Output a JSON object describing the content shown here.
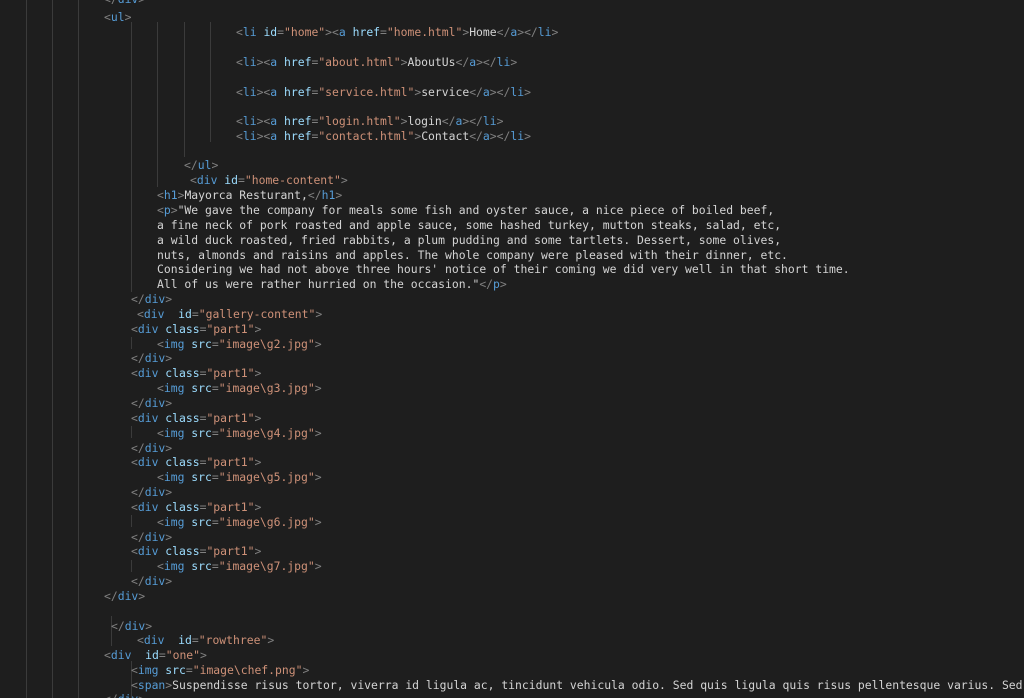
{
  "colors": {
    "background": "#1e1e1e",
    "tag": "#569cd6",
    "punctuation": "#808080",
    "attribute": "#9cdcfe",
    "string": "#ce9178",
    "text": "#d4d4d4",
    "indent_guide": "#3b3b3b"
  },
  "lines": [
    {
      "t": [
        [
          "p",
          "</"
        ],
        [
          "k",
          "div"
        ],
        [
          "p",
          ">"
        ]
      ]
    },
    {
      "t": [
        [
          "p",
          "<"
        ],
        [
          "k",
          "ul"
        ],
        [
          "p",
          ">"
        ]
      ]
    },
    {
      "t": [
        [
          "p",
          "<"
        ],
        [
          "k",
          "li"
        ],
        [
          "w",
          " "
        ],
        [
          "a",
          "id"
        ],
        [
          "p",
          "="
        ],
        [
          "s",
          "\"home\""
        ],
        [
          "p",
          "><"
        ],
        [
          "k",
          "a"
        ],
        [
          "w",
          " "
        ],
        [
          "a",
          "href"
        ],
        [
          "p",
          "="
        ],
        [
          "s",
          "\"home.html\""
        ],
        [
          "p",
          ">"
        ],
        [
          "x",
          "Home"
        ],
        [
          "p",
          "</"
        ],
        [
          "k",
          "a"
        ],
        [
          "p",
          "></"
        ],
        [
          "k",
          "li"
        ],
        [
          "p",
          ">"
        ]
      ]
    },
    {
      "t": [
        [
          "p",
          "<"
        ],
        [
          "k",
          "li"
        ],
        [
          "p",
          "><"
        ],
        [
          "k",
          "a"
        ],
        [
          "w",
          " "
        ],
        [
          "a",
          "href"
        ],
        [
          "p",
          "="
        ],
        [
          "s",
          "\"about.html\""
        ],
        [
          "p",
          ">"
        ],
        [
          "x",
          "AboutUs"
        ],
        [
          "p",
          "</"
        ],
        [
          "k",
          "a"
        ],
        [
          "p",
          "></"
        ],
        [
          "k",
          "li"
        ],
        [
          "p",
          ">"
        ]
      ]
    },
    {
      "t": [
        [
          "p",
          "<"
        ],
        [
          "k",
          "li"
        ],
        [
          "p",
          "><"
        ],
        [
          "k",
          "a"
        ],
        [
          "w",
          " "
        ],
        [
          "a",
          "href"
        ],
        [
          "p",
          "="
        ],
        [
          "s",
          "\"service.html\""
        ],
        [
          "p",
          ">"
        ],
        [
          "x",
          "service"
        ],
        [
          "p",
          "</"
        ],
        [
          "k",
          "a"
        ],
        [
          "p",
          "></"
        ],
        [
          "k",
          "li"
        ],
        [
          "p",
          ">"
        ]
      ]
    },
    {
      "t": [
        [
          "p",
          "<"
        ],
        [
          "k",
          "li"
        ],
        [
          "p",
          "><"
        ],
        [
          "k",
          "a"
        ],
        [
          "w",
          " "
        ],
        [
          "a",
          "href"
        ],
        [
          "p",
          "="
        ],
        [
          "s",
          "\"login.html\""
        ],
        [
          "p",
          ">"
        ],
        [
          "x",
          "login"
        ],
        [
          "p",
          "</"
        ],
        [
          "k",
          "a"
        ],
        [
          "p",
          "></"
        ],
        [
          "k",
          "li"
        ],
        [
          "p",
          ">"
        ]
      ]
    },
    {
      "t": [
        [
          "p",
          "<"
        ],
        [
          "k",
          "li"
        ],
        [
          "p",
          "><"
        ],
        [
          "k",
          "a"
        ],
        [
          "w",
          " "
        ],
        [
          "a",
          "href"
        ],
        [
          "p",
          "="
        ],
        [
          "s",
          "\"contact.html\""
        ],
        [
          "p",
          ">"
        ],
        [
          "x",
          "Contact"
        ],
        [
          "p",
          "</"
        ],
        [
          "k",
          "a"
        ],
        [
          "p",
          "></"
        ],
        [
          "k",
          "li"
        ],
        [
          "p",
          ">"
        ]
      ]
    },
    {
      "t": [
        [
          "p",
          "</"
        ],
        [
          "k",
          "ul"
        ],
        [
          "p",
          ">"
        ]
      ]
    },
    {
      "t": [
        [
          "p",
          "<"
        ],
        [
          "k",
          "div"
        ],
        [
          "w",
          " "
        ],
        [
          "a",
          "id"
        ],
        [
          "p",
          "="
        ],
        [
          "s",
          "\"home-content\""
        ],
        [
          "p",
          ">"
        ]
      ]
    },
    {
      "t": [
        [
          "p",
          "<"
        ],
        [
          "k",
          "h1"
        ],
        [
          "p",
          ">"
        ],
        [
          "x",
          "Mayorca Resturant,"
        ],
        [
          "p",
          "</"
        ],
        [
          "k",
          "h1"
        ],
        [
          "p",
          ">"
        ]
      ]
    },
    {
      "t": [
        [
          "p",
          "<"
        ],
        [
          "k",
          "p"
        ],
        [
          "p",
          ">"
        ],
        [
          "x",
          "\"We gave the company for meals some fish and oyster sauce, a nice piece of boiled beef,"
        ]
      ]
    },
    {
      "t": [
        [
          "x",
          "a fine neck of pork roasted and apple sauce, some hashed turkey, mutton steaks, salad, etc,"
        ]
      ]
    },
    {
      "t": [
        [
          "x",
          "a wild duck roasted, fried rabbits, a plum pudding and some tartlets. Dessert, some olives,"
        ]
      ]
    },
    {
      "t": [
        [
          "x",
          "nuts, almonds and raisins and apples. The whole company were pleased with their dinner, etc."
        ]
      ]
    },
    {
      "t": [
        [
          "x",
          "Considering we had not above three hours' notice of their coming we did very well in that short time."
        ]
      ]
    },
    {
      "t": [
        [
          "x",
          "All of us were rather hurried on the occasion.\""
        ],
        [
          "p",
          "</"
        ],
        [
          "k",
          "p"
        ],
        [
          "p",
          ">"
        ]
      ]
    },
    {
      "t": [
        [
          "p",
          "</"
        ],
        [
          "k",
          "div"
        ],
        [
          "p",
          ">"
        ]
      ]
    },
    {
      "t": [
        [
          "p",
          "<"
        ],
        [
          "k",
          "div"
        ],
        [
          "w",
          "  "
        ],
        [
          "a",
          "id"
        ],
        [
          "p",
          "="
        ],
        [
          "s",
          "\"gallery-content\""
        ],
        [
          "p",
          ">"
        ]
      ]
    },
    {
      "t": [
        [
          "p",
          "<"
        ],
        [
          "k",
          "div"
        ],
        [
          "w",
          " "
        ],
        [
          "a",
          "class"
        ],
        [
          "p",
          "="
        ],
        [
          "s",
          "\"part1\""
        ],
        [
          "p",
          ">"
        ]
      ]
    },
    {
      "t": [
        [
          "p",
          "<"
        ],
        [
          "k",
          "img"
        ],
        [
          "w",
          " "
        ],
        [
          "a",
          "src"
        ],
        [
          "p",
          "="
        ],
        [
          "s",
          "\"image\\g2.jpg\""
        ],
        [
          "p",
          ">"
        ]
      ]
    },
    {
      "t": [
        [
          "p",
          "</"
        ],
        [
          "k",
          "div"
        ],
        [
          "p",
          ">"
        ]
      ]
    },
    {
      "t": [
        [
          "p",
          "<"
        ],
        [
          "k",
          "div"
        ],
        [
          "w",
          " "
        ],
        [
          "a",
          "class"
        ],
        [
          "p",
          "="
        ],
        [
          "s",
          "\"part1\""
        ],
        [
          "p",
          ">"
        ]
      ]
    },
    {
      "t": [
        [
          "p",
          "<"
        ],
        [
          "k",
          "img"
        ],
        [
          "w",
          " "
        ],
        [
          "a",
          "src"
        ],
        [
          "p",
          "="
        ],
        [
          "s",
          "\"image\\g3.jpg\""
        ],
        [
          "p",
          ">"
        ]
      ]
    },
    {
      "t": [
        [
          "p",
          "</"
        ],
        [
          "k",
          "div"
        ],
        [
          "p",
          ">"
        ]
      ]
    },
    {
      "t": [
        [
          "p",
          "<"
        ],
        [
          "k",
          "div"
        ],
        [
          "w",
          " "
        ],
        [
          "a",
          "class"
        ],
        [
          "p",
          "="
        ],
        [
          "s",
          "\"part1\""
        ],
        [
          "p",
          ">"
        ]
      ]
    },
    {
      "t": [
        [
          "p",
          "<"
        ],
        [
          "k",
          "img"
        ],
        [
          "w",
          " "
        ],
        [
          "a",
          "src"
        ],
        [
          "p",
          "="
        ],
        [
          "s",
          "\"image\\g4.jpg\""
        ],
        [
          "p",
          ">"
        ]
      ]
    },
    {
      "t": [
        [
          "p",
          "</"
        ],
        [
          "k",
          "div"
        ],
        [
          "p",
          ">"
        ]
      ]
    },
    {
      "t": [
        [
          "p",
          "<"
        ],
        [
          "k",
          "div"
        ],
        [
          "w",
          " "
        ],
        [
          "a",
          "class"
        ],
        [
          "p",
          "="
        ],
        [
          "s",
          "\"part1\""
        ],
        [
          "p",
          ">"
        ]
      ]
    },
    {
      "t": [
        [
          "p",
          "<"
        ],
        [
          "k",
          "img"
        ],
        [
          "w",
          " "
        ],
        [
          "a",
          "src"
        ],
        [
          "p",
          "="
        ],
        [
          "s",
          "\"image\\g5.jpg\""
        ],
        [
          "p",
          ">"
        ]
      ]
    },
    {
      "t": [
        [
          "p",
          "</"
        ],
        [
          "k",
          "div"
        ],
        [
          "p",
          ">"
        ]
      ]
    },
    {
      "t": [
        [
          "p",
          "<"
        ],
        [
          "k",
          "div"
        ],
        [
          "w",
          " "
        ],
        [
          "a",
          "class"
        ],
        [
          "p",
          "="
        ],
        [
          "s",
          "\"part1\""
        ],
        [
          "p",
          ">"
        ]
      ]
    },
    {
      "t": [
        [
          "p",
          "<"
        ],
        [
          "k",
          "img"
        ],
        [
          "w",
          " "
        ],
        [
          "a",
          "src"
        ],
        [
          "p",
          "="
        ],
        [
          "s",
          "\"image\\g6.jpg\""
        ],
        [
          "p",
          ">"
        ]
      ]
    },
    {
      "t": [
        [
          "p",
          "</"
        ],
        [
          "k",
          "div"
        ],
        [
          "p",
          ">"
        ]
      ]
    },
    {
      "t": [
        [
          "p",
          "<"
        ],
        [
          "k",
          "div"
        ],
        [
          "w",
          " "
        ],
        [
          "a",
          "class"
        ],
        [
          "p",
          "="
        ],
        [
          "s",
          "\"part1\""
        ],
        [
          "p",
          ">"
        ]
      ]
    },
    {
      "t": [
        [
          "p",
          "<"
        ],
        [
          "k",
          "img"
        ],
        [
          "w",
          " "
        ],
        [
          "a",
          "src"
        ],
        [
          "p",
          "="
        ],
        [
          "s",
          "\"image\\g7.jpg\""
        ],
        [
          "p",
          ">"
        ]
      ]
    },
    {
      "t": [
        [
          "p",
          "</"
        ],
        [
          "k",
          "div"
        ],
        [
          "p",
          ">"
        ]
      ]
    },
    {
      "t": [
        [
          "p",
          "</"
        ],
        [
          "k",
          "div"
        ],
        [
          "p",
          ">"
        ]
      ]
    },
    {
      "t": [
        [
          "p",
          "</"
        ],
        [
          "k",
          "div"
        ],
        [
          "p",
          ">"
        ]
      ]
    },
    {
      "t": [
        [
          "p",
          "<"
        ],
        [
          "k",
          "div"
        ],
        [
          "w",
          "  "
        ],
        [
          "a",
          "id"
        ],
        [
          "p",
          "="
        ],
        [
          "s",
          "\"rowthree\""
        ],
        [
          "p",
          ">"
        ]
      ]
    },
    {
      "t": [
        [
          "p",
          "<"
        ],
        [
          "k",
          "div"
        ],
        [
          "w",
          "  "
        ],
        [
          "a",
          "id"
        ],
        [
          "p",
          "="
        ],
        [
          "s",
          "\"one\""
        ],
        [
          "p",
          ">"
        ]
      ]
    },
    {
      "t": [
        [
          "p",
          "<"
        ],
        [
          "k",
          "img"
        ],
        [
          "w",
          " "
        ],
        [
          "a",
          "src"
        ],
        [
          "p",
          "="
        ],
        [
          "s",
          "\"image\\chef.png\""
        ],
        [
          "p",
          ">"
        ]
      ]
    },
    {
      "t": [
        [
          "p",
          "<"
        ],
        [
          "k",
          "span"
        ],
        [
          "p",
          ">"
        ],
        [
          "x",
          "Suspendisse risus tortor, viverra id ligula ac, tincidunt vehicula odio. Sed quis ligula quis risus pellentesque varius. Sed velit"
        ]
      ]
    },
    {
      "t": [
        [
          "p",
          "</"
        ],
        [
          "k",
          "div"
        ],
        [
          "p",
          ">"
        ]
      ]
    }
  ]
}
